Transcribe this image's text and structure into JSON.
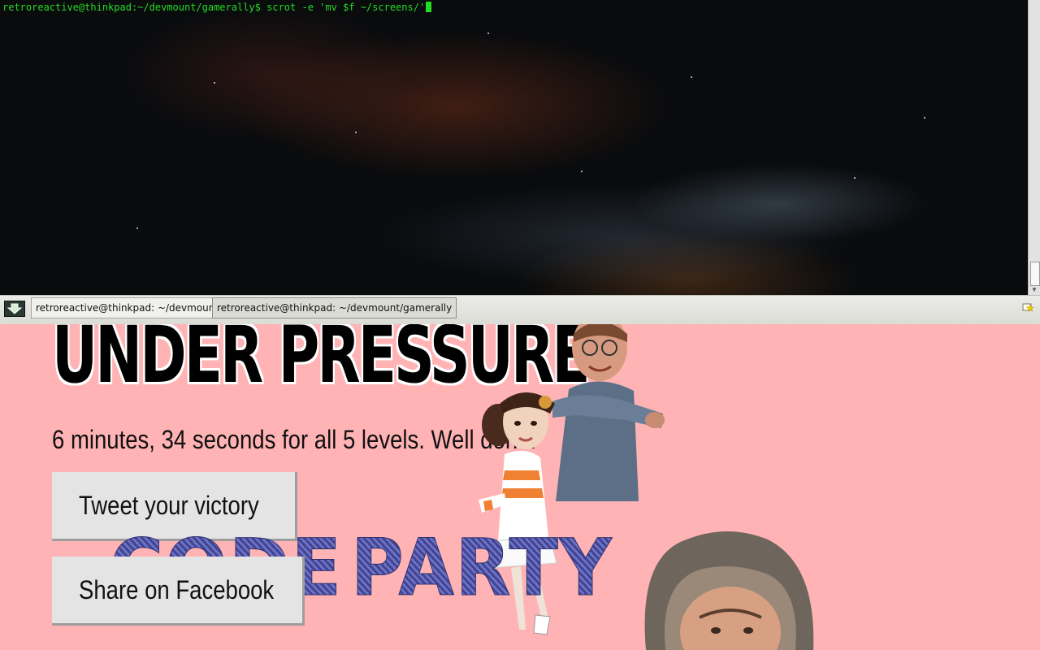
{
  "terminal": {
    "prompt": "retroreactive@thinkpad:~/devmount/gamerally$",
    "command": " scrot -e 'mv $f ~/screens/'"
  },
  "taskbar": {
    "menu_icon": "download-arrow-icon",
    "tasks": [
      {
        "label": "retroreactive@thinkpad: ~/devmount"
      },
      {
        "label": "retroreactive@thinkpad: ~/devmount/gamerally"
      }
    ],
    "tray_icon": "notification-flag-icon"
  },
  "page": {
    "title": "UNDER PRESSURE",
    "result": "6 minutes, 34 seconds for all 5 levels. Well done!",
    "tweet_button": "Tweet your victory",
    "share_button": "Share on Facebook",
    "party_word_1": "CODE",
    "party_word_2": "PARTY"
  },
  "colors": {
    "page_background": "#ffb3b4",
    "terminal_text": "#22dd22",
    "party_text": "#4b4fa4"
  }
}
